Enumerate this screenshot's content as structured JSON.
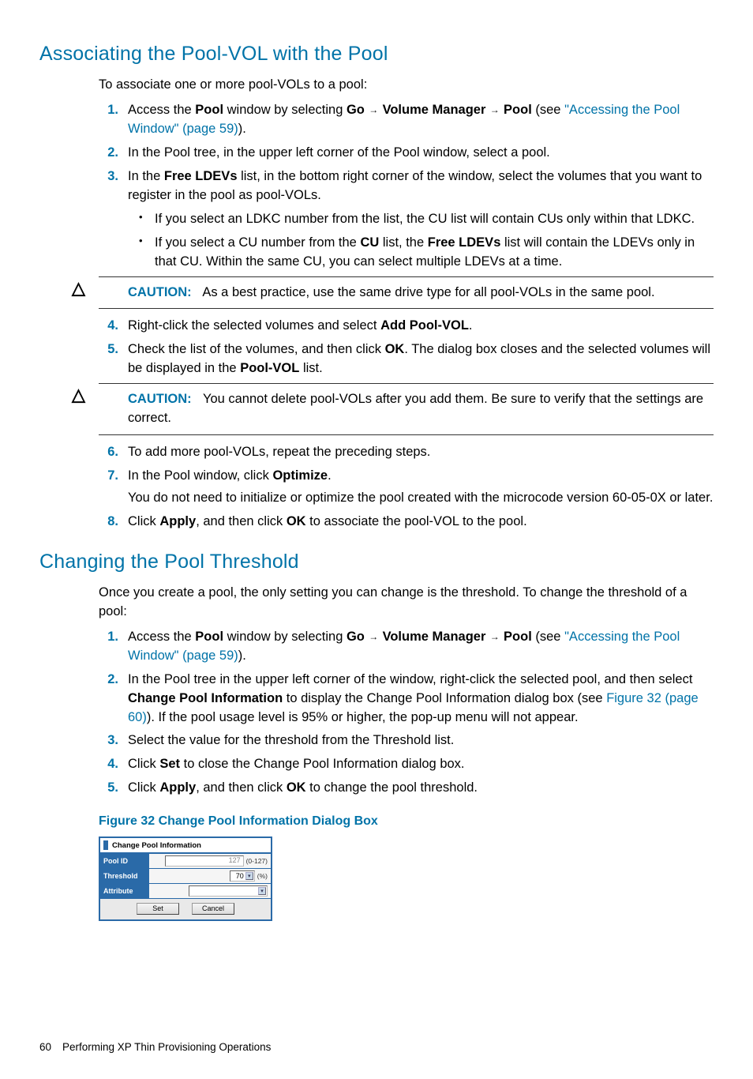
{
  "section1": {
    "heading": "Associating the Pool-VOL with the Pool",
    "intro": "To associate one or more pool-VOLs to a pool:"
  },
  "s1": {
    "step1_a": "Access the ",
    "step1_b": "Pool",
    "step1_c": " window by selecting ",
    "step1_d": "Go",
    "step1_e": "Volume Manager",
    "step1_f": "Pool",
    "step1_g": " (see ",
    "step1_link": "\"Accessing the Pool Window\" (page 59)",
    "step1_h": ").",
    "step2": "In the Pool tree, in the upper left corner of the Pool window, select a pool.",
    "step3_a": "In the ",
    "step3_b": "Free LDEVs",
    "step3_c": " list, in the bottom right corner of the window, select the volumes that you want to register in the pool as pool-VOLs.",
    "s3b1": "If you select an LDKC number from the list, the CU list will contain CUs only within that LDKC.",
    "s3b2_a": "If you select a CU number from the ",
    "s3b2_b": "CU",
    "s3b2_c": " list, the ",
    "s3b2_d": "Free LDEVs",
    "s3b2_e": " list will contain the LDEVs only in that CU. Within the same CU, you can select multiple LDEVs at a time.",
    "caution1": "As a best practice, use the same drive type for all pool-VOLs in the same pool.",
    "step4_a": "Right-click the selected volumes and select ",
    "step4_b": "Add Pool-VOL",
    "step4_c": ".",
    "step5_a": "Check the list of the volumes, and then click ",
    "step5_b": "OK",
    "step5_c": ". The dialog box closes and the selected volumes will be displayed in the ",
    "step5_d": "Pool-VOL",
    "step5_e": " list.",
    "caution2": "You cannot delete pool-VOLs after you add them. Be sure to verify that the settings are correct.",
    "step6": "To add more pool-VOLs, repeat the preceding steps.",
    "step7_a": "In the Pool window, click ",
    "step7_b": "Optimize",
    "step7_c": ".",
    "step7_note": "You do not need to initialize or optimize the pool created with the microcode version 60-05-0X or later.",
    "step8_a": "Click ",
    "step8_b": "Apply",
    "step8_c": ", and then click ",
    "step8_d": "OK",
    "step8_e": " to associate the pool-VOL to the pool."
  },
  "section2": {
    "heading": "Changing the Pool Threshold",
    "intro": "Once you create a pool, the only setting you can change is the threshold. To change the threshold of a pool:"
  },
  "s2": {
    "step1_a": "Access the ",
    "step1_b": "Pool",
    "step1_c": " window by selecting ",
    "step1_d": "Go",
    "step1_e": "Volume Manager",
    "step1_f": "Pool",
    "step1_g": " (see ",
    "step1_link": "\"Accessing the Pool Window\" (page 59)",
    "step1_h": ").",
    "step2_a": "In the Pool tree in the upper left corner of the window, right-click the selected pool, and then select ",
    "step2_b": "Change Pool Information",
    "step2_c": " to display the Change Pool Information dialog box (see ",
    "step2_link": "Figure 32 (page 60)",
    "step2_d": "). If the pool usage level is 95% or higher, the pop-up menu will not appear.",
    "step3": "Select the value for the threshold from the Threshold list.",
    "step4_a": "Click ",
    "step4_b": "Set",
    "step4_c": " to close the Change Pool Information dialog box.",
    "step5_a": "Click ",
    "step5_b": "Apply",
    "step5_c": ", and then click ",
    "step5_d": "OK",
    "step5_e": " to change the pool threshold."
  },
  "figure": {
    "title": "Figure 32 Change Pool Information Dialog Box",
    "dlg_title": "Change Pool Information",
    "rows": {
      "poolid_label": "Pool ID",
      "poolid_value": "127",
      "poolid_range": "(0-127)",
      "threshold_label": "Threshold",
      "threshold_value": "70",
      "threshold_unit": "(%)",
      "attribute_label": "Attribute"
    },
    "buttons": {
      "set": "Set",
      "cancel": "Cancel"
    }
  },
  "labels": {
    "caution": "CAUTION:"
  },
  "nums": {
    "n1": "1.",
    "n2": "2.",
    "n3": "3.",
    "n4": "4.",
    "n5": "5.",
    "n6": "6.",
    "n7": "7.",
    "n8": "8."
  },
  "footer": {
    "page": "60",
    "title": "Performing XP Thin Provisioning Operations"
  }
}
